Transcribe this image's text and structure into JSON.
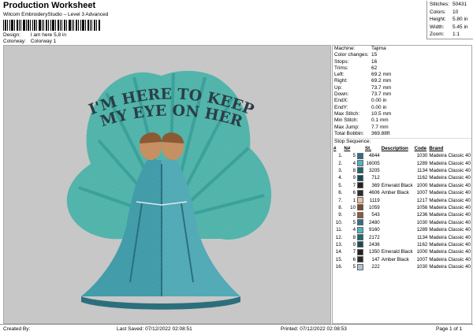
{
  "header": {
    "title": "Production Worksheet",
    "subtitle": "Wilcom EmbroideryStudio – Level 3 Advanced",
    "design_label": "Design:",
    "design_value": "I am here 5,8 in",
    "colorway_label": "Colorway:",
    "colorway_value": "Colorway 1"
  },
  "stats": [
    {
      "k": "Stitches:",
      "v": "50431"
    },
    {
      "k": "Colors:",
      "v": "10"
    },
    {
      "k": "Height:",
      "v": "5.80 in"
    },
    {
      "k": "Width:",
      "v": "5.45 in"
    },
    {
      "k": "Zoom:",
      "v": "1:1"
    }
  ],
  "design_text": {
    "line1": "I'M HERE TO KEEP",
    "line2": "MY EYE ON HER"
  },
  "info": [
    {
      "k": "Machine:",
      "v": "Tajima"
    },
    {
      "k": "Color changes:",
      "v": "15"
    },
    {
      "k": "Stops:",
      "v": "16"
    },
    {
      "k": "Trims:",
      "v": "62"
    },
    {
      "k": "Left:",
      "v": "69.2 mm"
    },
    {
      "k": "Right:",
      "v": "69.2 mm"
    },
    {
      "k": "Up:",
      "v": "73.7 mm"
    },
    {
      "k": "Down:",
      "v": "73.7 mm"
    },
    {
      "k": "EndX:",
      "v": "0.00 in"
    },
    {
      "k": "EndY:",
      "v": "0.00 in"
    },
    {
      "k": "Max Stitch:",
      "v": "10.5 mm"
    },
    {
      "k": "Min Stitch:",
      "v": "0.1 mm"
    },
    {
      "k": "Max Jump:",
      "v": "7.7 mm"
    },
    {
      "k": "Total Bobbin:",
      "v": "369.88ft"
    }
  ],
  "stop_sequence_label": "Stop Sequence:",
  "stop_columns": [
    "#",
    "N#",
    "St.",
    "Description",
    "Code",
    "Brand"
  ],
  "stops": [
    {
      "n": "1.",
      "nn": "5",
      "color": "#2f6f8a",
      "st": "4844",
      "desc": "",
      "code": "1030",
      "brand": "Madeira Classic 40"
    },
    {
      "n": "2.",
      "nn": "4",
      "color": "#4db3c6",
      "st": "16005",
      "desc": "",
      "code": "1289",
      "brand": "Madeira Classic 40"
    },
    {
      "n": "3.",
      "nn": "8",
      "color": "#1a6a6a",
      "st": "3205",
      "desc": "",
      "code": "1134",
      "brand": "Madeira Classic 40"
    },
    {
      "n": "4.",
      "nn": "9",
      "color": "#174a5a",
      "st": "712",
      "desc": "",
      "code": "1162",
      "brand": "Madeira Classic 40"
    },
    {
      "n": "5.",
      "nn": "7",
      "color": "#222222",
      "st": "369",
      "desc": "Emerald Black",
      "code": "1000",
      "brand": "Madeira Classic 40"
    },
    {
      "n": "6.",
      "nn": "6",
      "color": "#2b2b2b",
      "st": "4606",
      "desc": "Amber Black",
      "code": "1007",
      "brand": "Madeira Classic 40"
    },
    {
      "n": "7.",
      "nn": "1",
      "color": "#e8c0a0",
      "st": "1119",
      "desc": "",
      "code": "1217",
      "brand": "Madeira Classic 40"
    },
    {
      "n": "8.",
      "nn": "10",
      "color": "#7a4a2a",
      "st": "1059",
      "desc": "",
      "code": "1056",
      "brand": "Madeira Classic 40"
    },
    {
      "n": "9.",
      "nn": "3",
      "color": "#8c5a3a",
      "st": "543",
      "desc": "",
      "code": "1236",
      "brand": "Madeira Classic 40"
    },
    {
      "n": "10.",
      "nn": "5",
      "color": "#2f6f8a",
      "st": "2480",
      "desc": "",
      "code": "1030",
      "brand": "Madeira Classic 40"
    },
    {
      "n": "11.",
      "nn": "4",
      "color": "#4db3c6",
      "st": "9160",
      "desc": "",
      "code": "1289",
      "brand": "Madeira Classic 40"
    },
    {
      "n": "12.",
      "nn": "8",
      "color": "#1a6a6a",
      "st": "2172",
      "desc": "",
      "code": "1134",
      "brand": "Madeira Classic 40"
    },
    {
      "n": "13.",
      "nn": "9",
      "color": "#174a5a",
      "st": "2436",
      "desc": "",
      "code": "1162",
      "brand": "Madeira Classic 40"
    },
    {
      "n": "14.",
      "nn": "7",
      "color": "#222222",
      "st": "1350",
      "desc": "Emerald Black",
      "code": "1000",
      "brand": "Madeira Classic 40"
    },
    {
      "n": "15.",
      "nn": "6",
      "color": "#2b2b2b",
      "st": "147",
      "desc": "Amber Black",
      "code": "1007",
      "brand": "Madeira Classic 40"
    },
    {
      "n": "16.",
      "nn": "5",
      "color": "#a9c4dc",
      "st": "222",
      "desc": "",
      "code": "1030",
      "brand": "Madeira Classic 40"
    }
  ],
  "footer": {
    "created": "Created By:",
    "saved": "Last Saved: 07/12/2022 02:08:51",
    "printed": "Printed: 07/12/2022 02:08:53",
    "page": "Page 1 of 1"
  },
  "colors": {
    "canvas_bg": "#c7c7c7",
    "fan_light": "#5fbfb6",
    "fan_dark": "#2a8f8c",
    "dress": "#3f9aa8",
    "dress_dark": "#2c6f7c",
    "skin": "#d9a57a"
  }
}
